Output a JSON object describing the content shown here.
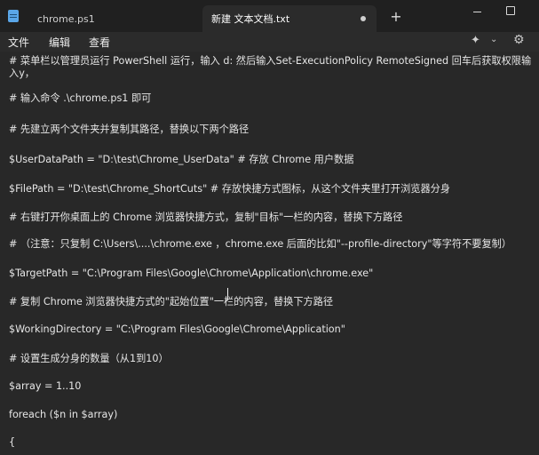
{
  "tabs": [
    {
      "label": "chrome.ps1"
    },
    {
      "label": "新建 文本文档.txt"
    }
  ],
  "menu": {
    "file": "文件",
    "edit": "编辑",
    "view": "查看"
  },
  "icons": {
    "app": "notepad-icon",
    "new_tab": "+",
    "ai": "✦",
    "chevron": "⌄",
    "gear": "⚙"
  },
  "editor": {
    "lines": [
      "# 菜单栏以管理员运行 PowerShell 运行，输入 d: 然后输入Set-ExecutionPolicy RemoteSigned 回车后获取权限输",
      "入y，",
      "# 输入命令 .\\chrome.ps1 即可",
      "# 先建立两个文件夹并复制其路径，替换以下两个路径",
      "$UserDataPath = \"D:\\test\\Chrome_UserData\" # 存放 Chrome 用户数据",
      "$FilePath = \"D:\\test\\Chrome_ShortCuts\"   # 存放快捷方式图标，从这个文件夹里打开浏览器分身",
      "# 右键打开你桌面上的 Chrome 浏览器快捷方式，复制\"目标\"一栏的内容，替换下方路径",
      "# （注意：只复制 C:\\Users\\....\\chrome.exe ，chrome.exe 后面的比如\"--profile-directory\"等字符不要复制）",
      "$TargetPath = \"C:\\Program Files\\Google\\Chrome\\Application\\chrome.exe\"",
      "# 复制 Chrome 浏览器快捷方式的\"起始位置\"一栏的内容，替换下方路径",
      "$WorkingDirectory = \"C:\\Program Files\\Google\\Chrome\\Application\"",
      "# 设置生成分身的数量（从1到10）",
      "$array = 1..10",
      "foreach ($n in $array)",
      "{"
    ]
  }
}
